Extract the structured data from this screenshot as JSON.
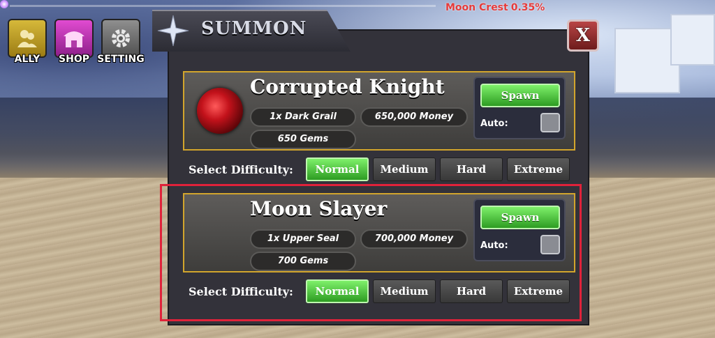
{
  "hud": {
    "moon_crest_label": "Moon Crest",
    "moon_crest_value": "0.35%"
  },
  "side_menu": {
    "ally": "ALLY",
    "shop": "SHOP",
    "setting": "SETTING"
  },
  "summon": {
    "title": "SUMMON",
    "close": "X",
    "bosses": [
      {
        "name": "Corrupted Knight",
        "requirement": "1x Dark Grail",
        "money": "650,000 Money",
        "gems": "650 Gems",
        "spawn": "Spawn",
        "auto": "Auto:"
      },
      {
        "name": "Moon Slayer",
        "requirement": "1x Upper Seal",
        "money": "700,000 Money",
        "gems": "700 Gems",
        "spawn": "Spawn",
        "auto": "Auto:"
      }
    ],
    "difficulty_label": "Select Difficulty:",
    "difficulties": [
      "Normal",
      "Medium",
      "Hard",
      "Extreme"
    ],
    "selected_difficulty": "Normal"
  },
  "colors": {
    "accent_green": "#2d9c22",
    "card_border": "#d2a52c",
    "highlight": "#e0223a",
    "moon_crest_text": "#e53b3b"
  }
}
